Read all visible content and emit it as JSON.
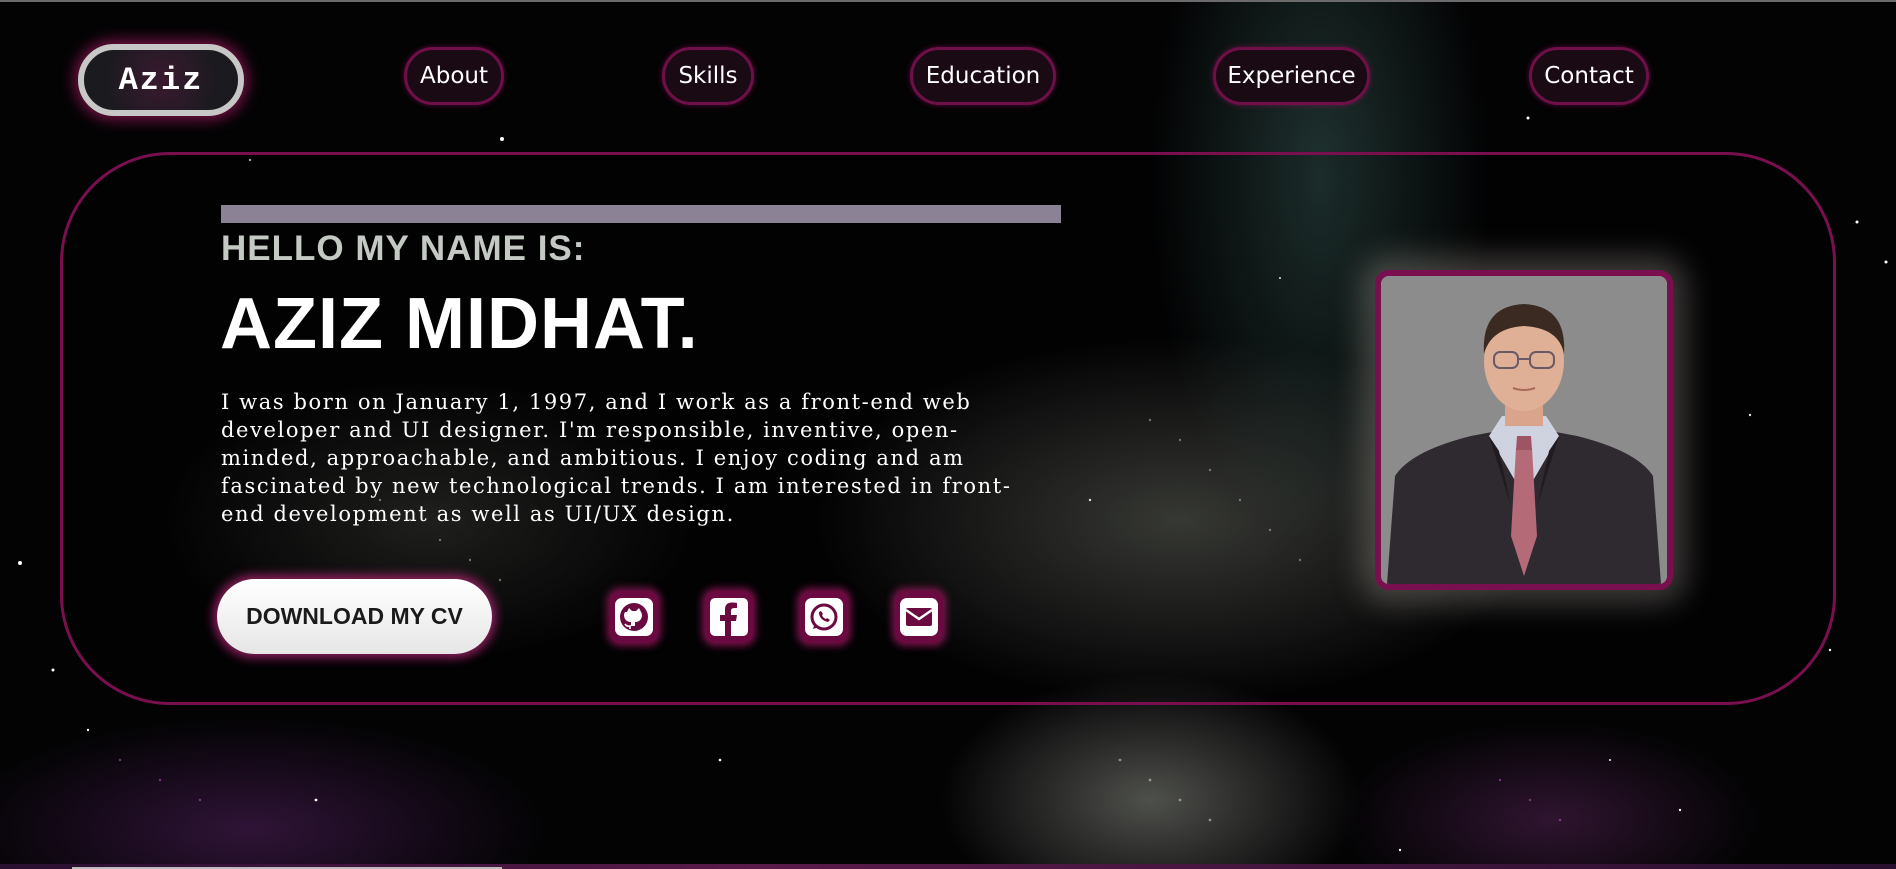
{
  "nav": {
    "logo": "Aziz",
    "items": [
      {
        "label": "About"
      },
      {
        "label": "Skills"
      },
      {
        "label": "Education"
      },
      {
        "label": "Experience"
      },
      {
        "label": "Contact"
      }
    ]
  },
  "hero": {
    "greeting": "HELLO MY NAME IS:",
    "name": "AZIZ MIDHAT.",
    "bio": "I was born on January 1, 1997, and I work as a front-end web developer and UI designer. I'm responsible, inventive, open-minded, approachable, and ambitious. I enjoy coding and am fascinated by new technological trends. I am interested in front-end development as well as UI/UX design.",
    "cv_button": "DOWNLOAD MY CV",
    "socials": [
      {
        "icon": "github-icon"
      },
      {
        "icon": "facebook-icon"
      },
      {
        "icon": "whatsapp-icon"
      },
      {
        "icon": "email-icon"
      }
    ]
  },
  "colors": {
    "accent": "#7a0f4f",
    "glow": "#d21e78",
    "background": "#030304"
  }
}
